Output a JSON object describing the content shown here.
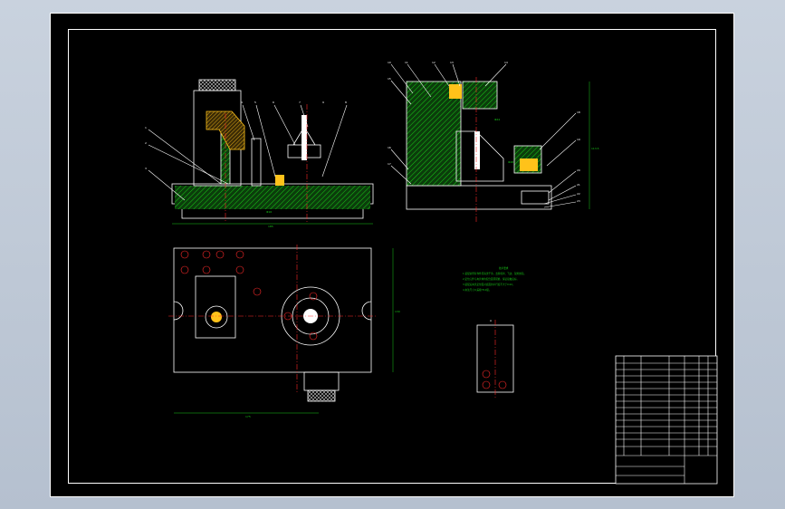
{
  "drawing": {
    "front_view": {
      "part_numbers": [
        "1",
        "2",
        "3",
        "4",
        "5",
        "6",
        "7",
        "8",
        "9"
      ],
      "base_dimension": "185",
      "slot_dimension": "Φ16"
    },
    "side_view": {
      "part_numbers": [
        "10",
        "11",
        "12",
        "13",
        "14",
        "15",
        "16",
        "17",
        "18",
        "19",
        "20",
        "21",
        "22",
        "23"
      ],
      "height_dimension": "113.5",
      "vertical_dim_1": "Φ24",
      "vertical_dim_2": "Φ48"
    },
    "top_view": {
      "vertical_dimension": "130",
      "horizontal_dimension": "175"
    },
    "section_view": {
      "label": "A"
    },
    "notes": {
      "title": "技术要求",
      "lines": [
        "1.装配前所有零件须清洗干净，去除毛刺、飞边、锐角倒钝。",
        "2.定位元件与夹具体的配合面须研磨，保证接触良好。",
        "3.装配后夹具定位面对底面的平行度不大于0.02。",
        "4.未注尺寸公差按IT12级。"
      ]
    },
    "colors": {
      "line": "#ffffff",
      "section_hatch": "#18c918",
      "center_line": "#ff2a2a",
      "dimension": "#18c918",
      "highlight": "#ffd83a",
      "note_text": "#18c918"
    }
  }
}
